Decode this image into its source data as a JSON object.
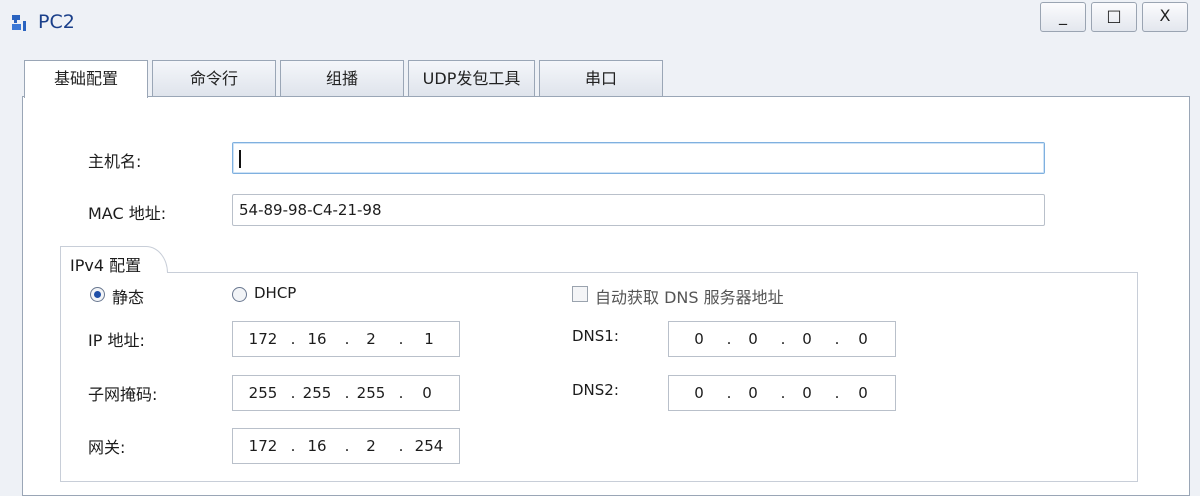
{
  "window": {
    "title": "PC2",
    "controls": {
      "minimize": "_",
      "maximize": "□",
      "close": "X"
    }
  },
  "tabs": [
    {
      "label": "基础配置",
      "active": true
    },
    {
      "label": "命令行",
      "active": false
    },
    {
      "label": "组播",
      "active": false
    },
    {
      "label": "UDP发包工具",
      "active": false
    },
    {
      "label": "串口",
      "active": false
    }
  ],
  "basic": {
    "hostname_label": "主机名:",
    "hostname_value": "",
    "mac_label": "MAC 地址:",
    "mac_value": "54-89-98-C4-21-98"
  },
  "ipv4": {
    "group_label": "IPv4 配置",
    "static_label": "静态",
    "dhcp_label": "DHCP",
    "mode": "static",
    "auto_dns_label": "自动获取 DNS 服务器地址",
    "auto_dns_checked": false,
    "ip_label": "IP 地址:",
    "ip": [
      "172",
      "16",
      "2",
      "1"
    ],
    "mask_label": "子网掩码:",
    "mask": [
      "255",
      "255",
      "255",
      "0"
    ],
    "gateway_label": "网关:",
    "gateway": [
      "172",
      "16",
      "2",
      "254"
    ],
    "dns1_label": "DNS1:",
    "dns1": [
      "0",
      "0",
      "0",
      "0"
    ],
    "dns2_label": "DNS2:",
    "dns2": [
      "0",
      "0",
      "0",
      "0"
    ]
  }
}
